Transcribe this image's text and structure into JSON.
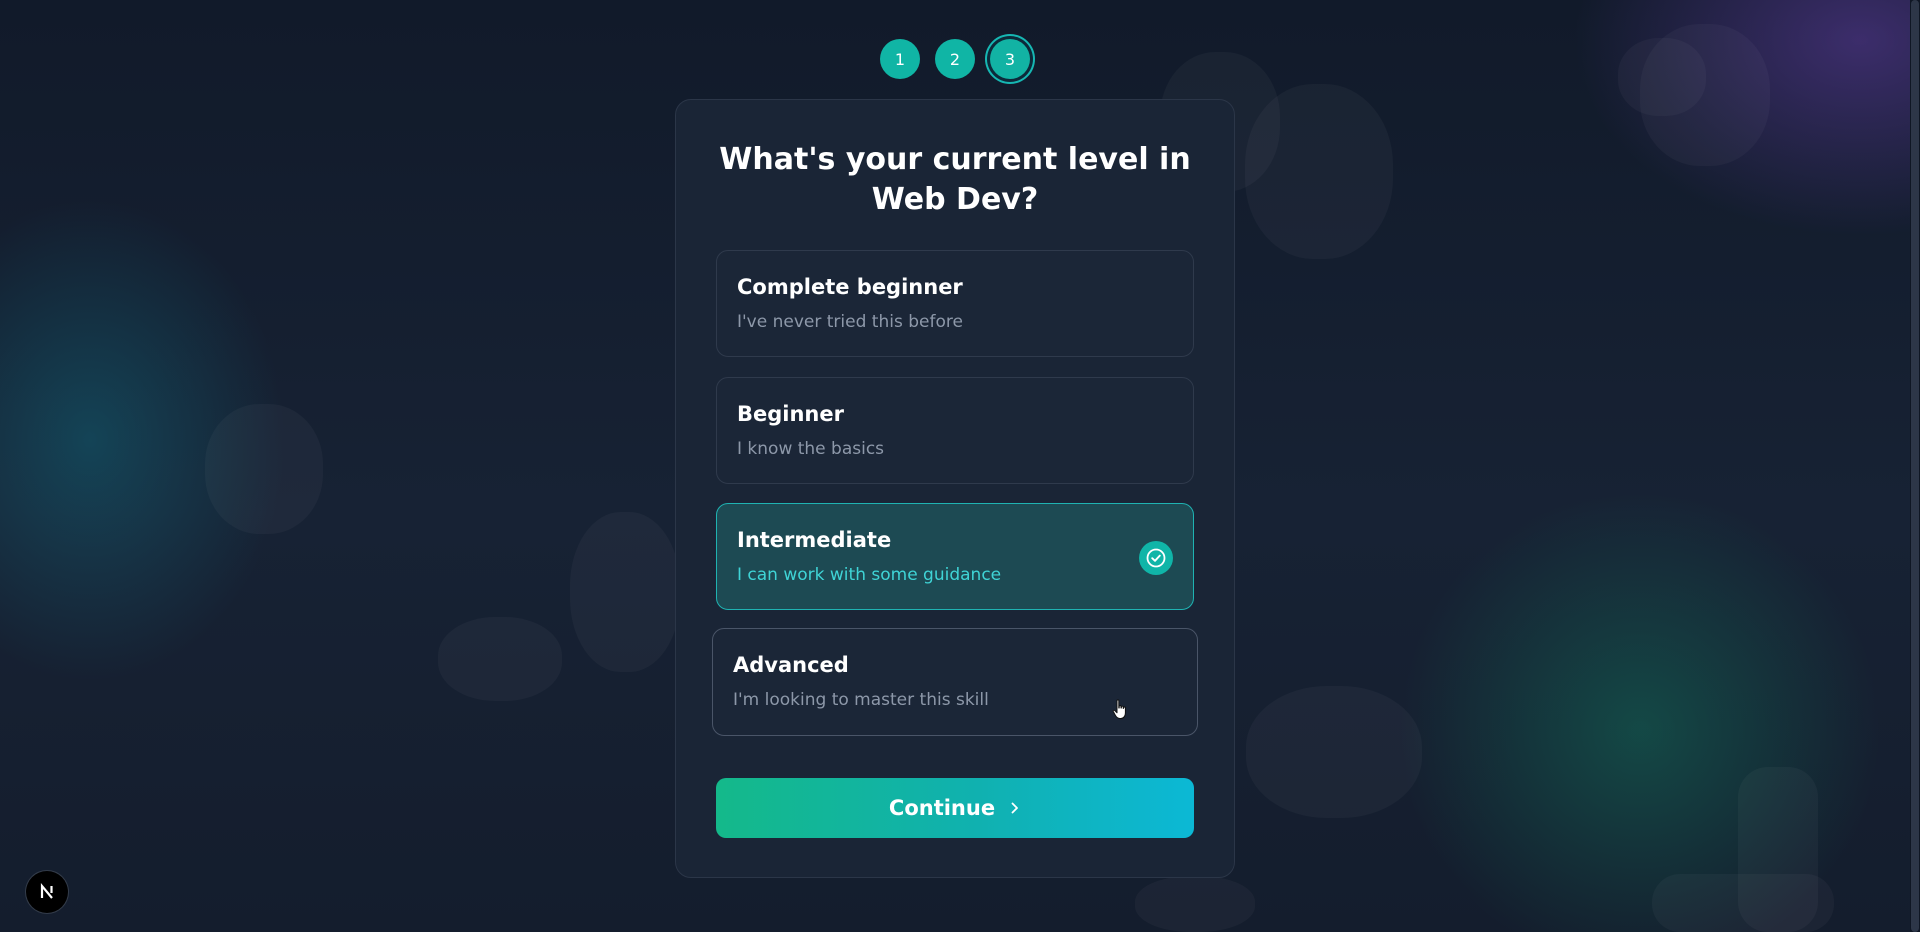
{
  "steps": [
    "1",
    "2",
    "3"
  ],
  "active_step": "3",
  "title": "What's your current level in Web Dev?",
  "options": [
    {
      "label": "Complete beginner",
      "description": "I've never tried this before"
    },
    {
      "label": "Beginner",
      "description": "I know the basics"
    },
    {
      "label": "Intermediate",
      "description": "I can work with some guidance"
    },
    {
      "label": "Advanced",
      "description": "I'm looking to master this skill"
    }
  ],
  "selected_option": "Intermediate",
  "continue_label": "Continue",
  "icons": {
    "selected_indicator": "check-circle-icon",
    "continue": "chevron-right-icon",
    "dev_tools": "nextjs-logo-icon"
  },
  "colors": {
    "accent": "#10b5a5",
    "selected_bg": "#1d4a53",
    "selected_desc": "#3fd4d6",
    "button_gradient_start": "#14b98a",
    "button_gradient_end": "#0cb8d5"
  }
}
